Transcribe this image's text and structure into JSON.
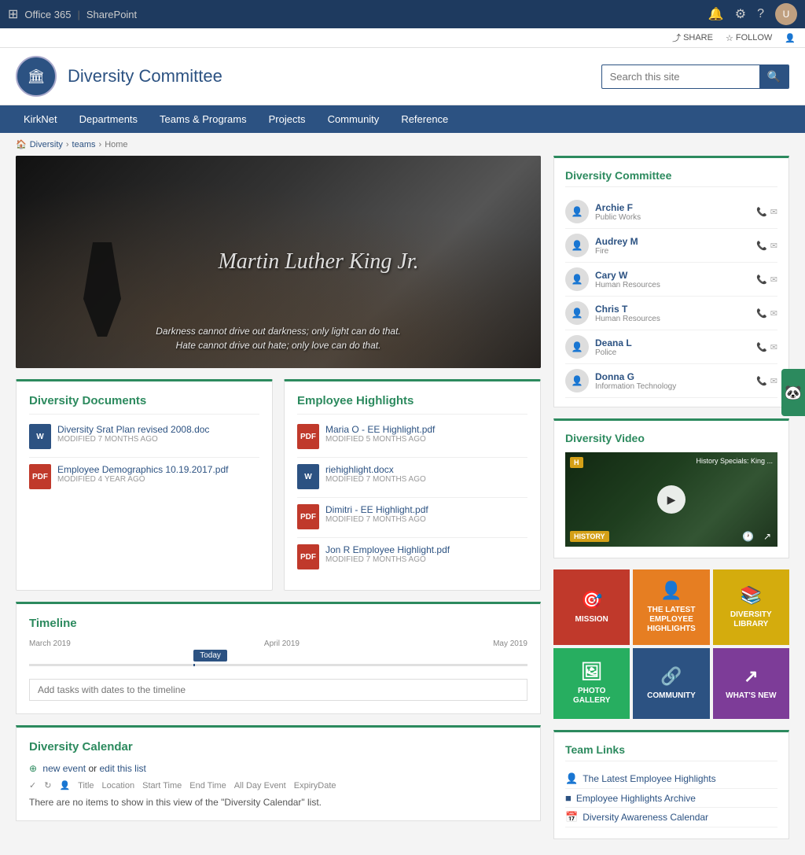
{
  "topbar": {
    "office365": "Office 365",
    "sharepoint": "SharePoint",
    "grid_icon": "⊞",
    "bell_icon": "🔔",
    "settings_icon": "⚙",
    "help_icon": "?",
    "avatar_text": "U"
  },
  "subtopbar": {
    "share": "SHARE",
    "follow": "FOLLOW"
  },
  "header": {
    "title": "Diversity Committee",
    "search_placeholder": "Search this site"
  },
  "nav": {
    "items": [
      {
        "label": "KirkNet",
        "id": "kirknet"
      },
      {
        "label": "Departments",
        "id": "departments"
      },
      {
        "label": "Teams & Programs",
        "id": "teams"
      },
      {
        "label": "Projects",
        "id": "projects"
      },
      {
        "label": "Community",
        "id": "community"
      },
      {
        "label": "Reference",
        "id": "reference"
      }
    ]
  },
  "breadcrumb": {
    "home_icon": "🏠",
    "items": [
      "Diversity",
      "teams",
      "Home"
    ]
  },
  "hero": {
    "signature": "Martin Luther King Jr.",
    "quote_line1": "Darkness cannot drive out darkness; only light can do that.",
    "quote_line2": "Hate cannot drive out hate; only love can do that."
  },
  "diversity_documents": {
    "title": "Diversity Documents",
    "items": [
      {
        "type": "word",
        "name": "Diversity Srat Plan revised 2008.doc",
        "modified": "MODIFIED 7 MONTHS AGO"
      },
      {
        "type": "pdf",
        "name": "Employee Demographics 10.19.2017.pdf",
        "modified": "MODIFIED 4 YEAR AGO"
      }
    ]
  },
  "employee_highlights": {
    "title": "Employee Highlights",
    "items": [
      {
        "type": "pdf",
        "name": "Maria O - EE Highlight.pdf",
        "modified": "MODIFIED 5 MONTHS AGO"
      },
      {
        "type": "word",
        "name": "riehighlight.docx",
        "modified": "MODIFIED 7 MONTHS AGO"
      },
      {
        "type": "pdf",
        "name": "Dimitri - EE Highlight.pdf",
        "modified": "MODIFIED 7 MONTHS AGO"
      },
      {
        "type": "pdf",
        "name": "Jon R Employee Highlight.pdf",
        "modified": "MODIFIED 7 MONTHS AGO"
      }
    ]
  },
  "timeline": {
    "title": "Timeline",
    "today_label": "Today",
    "labels": [
      "March 2019",
      "April 2019",
      "May 2019"
    ],
    "input_placeholder": "Add tasks with dates to the timeline",
    "col_headers": [
      "✓",
      "↻",
      "👤",
      "Title",
      "Location",
      "Start Time",
      "End Time",
      "All Day Event",
      "ExpiryDate"
    ]
  },
  "diversity_calendar": {
    "title": "Diversity Calendar",
    "new_event_text": "new event",
    "or_text": "or",
    "edit_text": "edit this list",
    "empty_message": "There are no items to show in this view of the \"Diversity Calendar\" list."
  },
  "committee": {
    "title": "Diversity Committee",
    "members": [
      {
        "name": "Archie F",
        "dept": "Public Works"
      },
      {
        "name": "Audrey M",
        "dept": "Fire"
      },
      {
        "name": "Cary W",
        "dept": "Human Resources"
      },
      {
        "name": "Chris T",
        "dept": "Human Resources"
      },
      {
        "name": "Deana L",
        "dept": "Police"
      },
      {
        "name": "Donna G",
        "dept": "Information Technology"
      }
    ]
  },
  "diversity_video": {
    "title": "Diversity Video",
    "video_label": "H",
    "video_title": "History Specials: King ..."
  },
  "tiles": [
    {
      "id": "mission",
      "class": "tile-mission",
      "icon": "🎯",
      "label": "MISSION"
    },
    {
      "id": "latest",
      "class": "tile-latest",
      "icon": "👤",
      "label": "THE LATEST EMPLOYEE HIGHLIGHTS"
    },
    {
      "id": "library",
      "class": "tile-library",
      "icon": "📚",
      "label": "DIVERSITY LIBRARY"
    },
    {
      "id": "gallery",
      "class": "tile-gallery",
      "icon": "🖼",
      "label": "PHOTO GALLERY"
    },
    {
      "id": "community",
      "class": "tile-community",
      "icon": "🔗",
      "label": "COMMUNITY"
    },
    {
      "id": "whatsnew",
      "class": "tile-whatsnew",
      "icon": "↗",
      "label": "WHAT'S NEW"
    }
  ],
  "team_links": {
    "title": "Team Links",
    "items": [
      {
        "icon": "👤",
        "label": "The Latest Employee Highlights"
      },
      {
        "icon": "■",
        "label": "Employee Highlights Archive"
      },
      {
        "icon": "📅",
        "label": "Diversity Awareness Calendar"
      }
    ]
  }
}
